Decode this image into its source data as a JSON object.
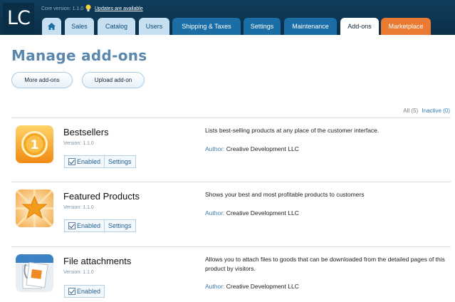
{
  "header": {
    "logo": "LC",
    "core_version": "Core version: 1.1.0",
    "updates_link": "Updates are available",
    "tabs": [
      {
        "label": ""
      },
      {
        "label": "Sales"
      },
      {
        "label": "Catalog"
      },
      {
        "label": "Users"
      },
      {
        "label": "Shipping & Taxes"
      },
      {
        "label": "Settings"
      },
      {
        "label": "Maintenance"
      },
      {
        "label": "Add-ons"
      },
      {
        "label": "Marketplace"
      }
    ]
  },
  "page": {
    "title": "Manage add-ons",
    "more_addons_label": "More add-ons",
    "upload_addon_label": "Upload add-on",
    "filter": {
      "all": "All (5)",
      "inactive": "Inactive (0)"
    }
  },
  "addons": [
    {
      "name": "Bestsellers",
      "version": "Version: 1.1.0",
      "enabled_label": "Enabled",
      "settings_label": "Settings",
      "description": "Lists best-selling products at any place of the customer interface.",
      "author_label": "Author:",
      "author": "Creative Development LLC",
      "icon": "bestseller-medal-icon"
    },
    {
      "name": "Featured Products",
      "version": "Version: 1.1.0",
      "enabled_label": "Enabled",
      "settings_label": "Settings",
      "description": "Shows your best and most profitable products to customers",
      "author_label": "Author:",
      "author": "Creative Development LLC",
      "icon": "featured-star-icon"
    },
    {
      "name": "File attachments",
      "version": "Version: 1.1.0",
      "enabled_label": "Enabled",
      "description": "Allows you to attach files to goods that can be downloaded from the detailed pages of this product by visitors.",
      "author_label": "Author:",
      "author": "Creative Development LLC",
      "icon": "file-attachment-icon"
    }
  ],
  "colors": {
    "header_bg": "#0f3d5c",
    "tab_dark": "#1a6da5",
    "tab_light": "#c6e0f2",
    "marketplace": "#ea7a32",
    "title": "#5a87ad"
  }
}
